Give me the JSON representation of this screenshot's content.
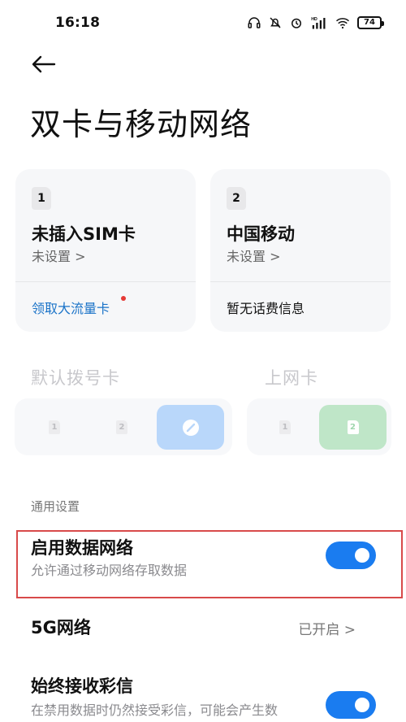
{
  "status_bar": {
    "time": "16:18",
    "battery": "74",
    "icons": [
      "headset-icon",
      "mute-icon",
      "alarm-icon",
      "hd-signal-icon",
      "wifi-icon",
      "battery-icon"
    ]
  },
  "page": {
    "title": "双卡与移动网络"
  },
  "sim_cards": [
    {
      "index": "1",
      "name": "未插入SIM卡",
      "status": "未设置 >",
      "footer": "领取大流量卡",
      "footer_color": "#1a73c8"
    },
    {
      "index": "2",
      "name": "中国移动",
      "status": "未设置 >",
      "footer": "暂无话费信息",
      "footer_color": "#111111"
    }
  ],
  "selectors": {
    "default_dial": {
      "label": "默认拨号卡",
      "options": [
        "1",
        "2"
      ],
      "selected_color": "#b9d7fa"
    },
    "data_card": {
      "label": "上网卡",
      "options": [
        "1",
        "2"
      ],
      "selected": "2",
      "selected_color": "#bfe6c8"
    }
  },
  "general": {
    "header": "通用设置",
    "settings": [
      {
        "title": "启用数据网络",
        "subtitle": "允许通过移动网络存取数据",
        "toggle_on": true
      },
      {
        "title": "5G网络",
        "value": "已开启 >"
      },
      {
        "title": "始终接收彩信",
        "subtitle": "在禁用数据时仍然接受彩信，可能会产生数",
        "toggle_on": true
      }
    ]
  },
  "colors": {
    "accent": "#1a7cf0",
    "highlight": "#d84a4a"
  }
}
